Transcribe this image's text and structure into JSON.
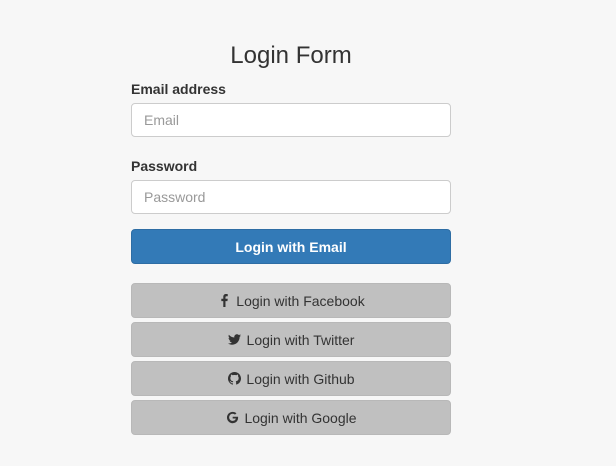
{
  "form": {
    "title": "Login Form",
    "email": {
      "label": "Email address",
      "placeholder": "Email",
      "value": ""
    },
    "password": {
      "label": "Password",
      "placeholder": "Password",
      "value": ""
    },
    "primary_button": {
      "label": "Login with Email",
      "color": "#337ab7"
    },
    "social_buttons": [
      {
        "label": "Login with Facebook",
        "icon": "facebook-icon"
      },
      {
        "label": "Login with Twitter",
        "icon": "twitter-icon"
      },
      {
        "label": "Login with Github",
        "icon": "github-icon"
      },
      {
        "label": "Login with Google",
        "icon": "google-icon"
      }
    ],
    "social_button_color": "#c0c0c0"
  }
}
